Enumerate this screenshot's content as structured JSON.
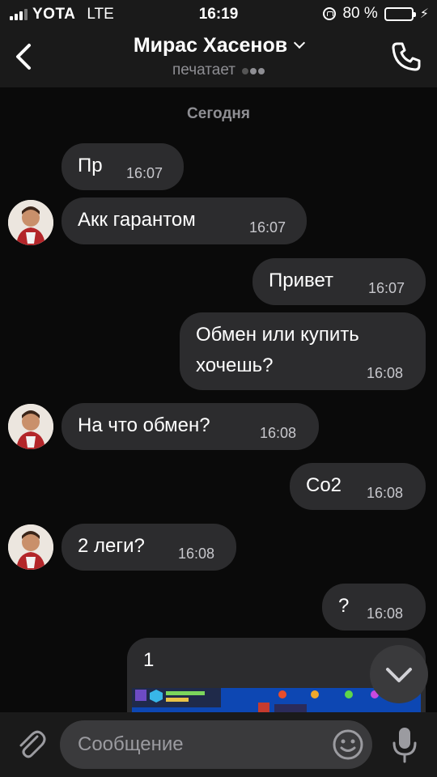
{
  "status_bar": {
    "carrier": "YOTA",
    "network": "LTE",
    "time": "16:19",
    "battery": "80 %",
    "battery_level": 0.8
  },
  "header": {
    "contact_name": "Мирас Хасенов",
    "status": "печатает"
  },
  "chat": {
    "date_separator": "Сегодня",
    "messages": [
      {
        "text": "Пр",
        "time": "16:07",
        "incoming": true
      },
      {
        "text": "Акк гарантом",
        "time": "16:07",
        "incoming": true
      },
      {
        "text": "Привет",
        "time": "16:07",
        "incoming": false
      },
      {
        "text_line1": "Обмен или купить",
        "text_line2": "хочешь?",
        "time": "16:08",
        "incoming": false
      },
      {
        "text": "На что обмен?",
        "time": "16:08",
        "incoming": true
      },
      {
        "text": "Со2",
        "time": "16:08",
        "incoming": false
      },
      {
        "text": "2 леги?",
        "time": "16:08",
        "incoming": true
      },
      {
        "text": "?",
        "time": "16:08",
        "incoming": false
      }
    ],
    "photo_message": {
      "caption": "1"
    }
  },
  "input": {
    "placeholder": "Сообщение"
  },
  "colors": {
    "background": "#0a0a0a",
    "bubble": "#2c2c2e",
    "bars": "#1a1a1a",
    "secondary_text": "#8e8e93",
    "battery_green": "#4cd964"
  }
}
